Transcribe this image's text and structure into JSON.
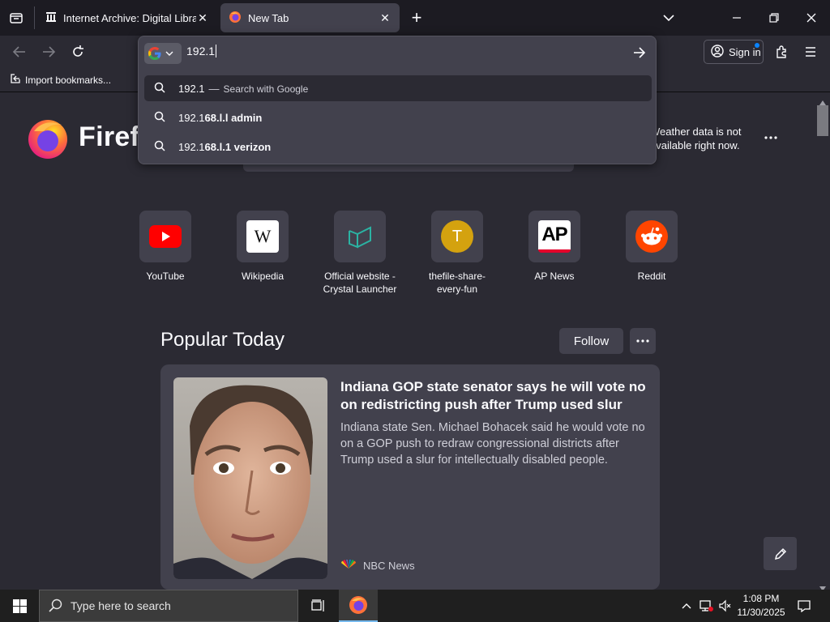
{
  "tabs": [
    {
      "title": "Internet Archive: Digital Library",
      "close": "✕"
    },
    {
      "title": "New Tab",
      "close": "✕"
    }
  ],
  "new_tab_symbol": "+",
  "urlbar": {
    "typed": "192.1",
    "suggestions": [
      {
        "prefix": "192.1",
        "rest": "",
        "separator": "—",
        "action": "Search with Google"
      },
      {
        "prefix": "192.1",
        "rest": "68.l.l admin"
      },
      {
        "prefix": "192.1",
        "rest": "68.l.1 verizon"
      }
    ]
  },
  "toolbar": {
    "sign_in": "Sign in"
  },
  "bookmarks": {
    "import": "Import bookmarks..."
  },
  "brand": {
    "name": "Firefo"
  },
  "weather": {
    "line1": "Weather data is not",
    "line2": "available right now."
  },
  "top_sites": [
    {
      "label": "YouTube"
    },
    {
      "label": "Wikipedia",
      "glyph": "W"
    },
    {
      "label": "Official website - Crystal Launcher"
    },
    {
      "label": "thefile-share-every-fun",
      "letter": "T"
    },
    {
      "label": "AP News",
      "glyph": "AP"
    },
    {
      "label": "Reddit"
    }
  ],
  "popular": {
    "title": "Popular Today",
    "follow": "Follow",
    "story": {
      "headline": "Indiana GOP state senator says he will vote no on redistricting push after Trump used slur",
      "excerpt": "Indiana state Sen. Michael Bohacek said he would vote no on a GOP push to redraw congressional districts after Trump used a slur for intellectually disabled people.",
      "source": "NBC News"
    }
  },
  "taskbar": {
    "search_placeholder": "Type here to search",
    "time": "1:08 PM",
    "date": "11/30/2025"
  },
  "colors": {
    "accent": "#0a84ff",
    "chrome_dark": "#1c1b22",
    "surface": "#2b2a33",
    "card": "#42414d"
  },
  "icons": [
    "tab-overview-icon",
    "archive-icon",
    "firefox-icon",
    "list-all-tabs-icon",
    "minimize-icon",
    "restore-icon",
    "close-icon",
    "back-icon",
    "forward-icon",
    "reload-icon",
    "google-icon",
    "chevron-down-icon",
    "go-arrow-icon",
    "search-icon",
    "account-icon",
    "extensions-icon",
    "menu-icon",
    "import-icon",
    "youtube-icon",
    "wikipedia-icon",
    "crystal-launcher-icon",
    "ap-icon",
    "reddit-icon",
    "more-icon",
    "pencil-icon",
    "nbc-icon",
    "windows-icon",
    "task-view-icon",
    "network-icon",
    "volume-muted-icon",
    "notification-icon",
    "chevron-up-icon"
  ]
}
